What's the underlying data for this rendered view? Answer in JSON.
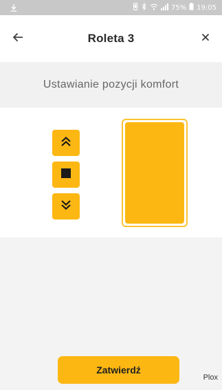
{
  "status_bar": {
    "icons": [
      "download-icon",
      "vibrate-icon",
      "bluetooth-icon",
      "wifi-icon",
      "signal-icon",
      "battery-icon"
    ],
    "battery_text": "75%",
    "time": "19:05"
  },
  "header": {
    "title": "Roleta 3",
    "back_icon": "arrow-left-icon",
    "close_icon": "close-icon"
  },
  "subtitle": "Ustawianie pozycji komfort",
  "controls": {
    "up_icon": "double-chevron-up-icon",
    "stop_icon": "stop-square-icon",
    "down_icon": "double-chevron-down-icon"
  },
  "blind": {
    "position_percent": 100
  },
  "confirm_label": "Zatwierdź",
  "brand": "Plox",
  "colors": {
    "accent": "#fcb713",
    "accent_border": "#fcc231",
    "status_bar": "#c8c8c8",
    "background": "#f3f3f3"
  }
}
